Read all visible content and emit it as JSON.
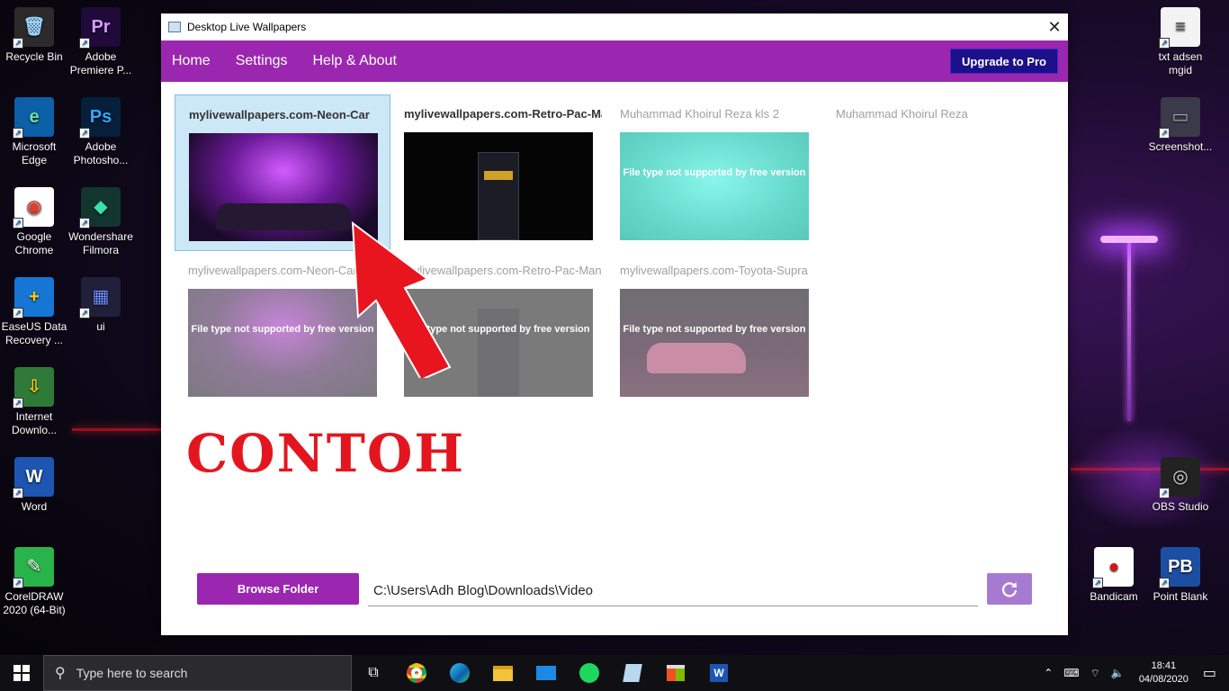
{
  "desktop": {
    "left_icons": [
      {
        "label": "Recycle Bin",
        "icon": "recycle-bin-icon",
        "glyph": "🗑",
        "bg": "#2b2b2b",
        "fg": "#9fd3ff"
      },
      {
        "label": "Adobe Premiere P...",
        "icon": "premiere-icon",
        "glyph": "Pr",
        "bg": "#1f0a3a",
        "fg": "#d79aff"
      },
      {
        "label": "Microsoft Edge",
        "icon": "edge-icon",
        "glyph": "e",
        "bg": "#0d5fa8",
        "fg": "#6ee0a5"
      },
      {
        "label": "Adobe Photosho...",
        "icon": "photoshop-icon",
        "glyph": "Ps",
        "bg": "#061f3a",
        "fg": "#2fa7ff"
      },
      {
        "label": "Google Chrome",
        "icon": "chrome-icon",
        "glyph": "◉",
        "bg": "#fff",
        "fg": "#e33b2e"
      },
      {
        "label": "Wondershare Filmora",
        "icon": "filmora-icon",
        "glyph": "◆",
        "bg": "#12362f",
        "fg": "#3de0a8"
      },
      {
        "label": "EaseUS Data Recovery ...",
        "icon": "easeus-icon",
        "glyph": "+",
        "bg": "#1576d4",
        "fg": "#ffcc00"
      },
      {
        "label": "ui",
        "icon": "folder-ui-icon",
        "glyph": "▦",
        "bg": "#20203a",
        "fg": "#6c8cff"
      },
      {
        "label": "Internet Downlo...",
        "icon": "idm-icon",
        "glyph": "⇩",
        "bg": "#2f7a38",
        "fg": "#ffd200"
      },
      {
        "label": "Word",
        "icon": "word-icon",
        "glyph": "W",
        "bg": "#1d55b2",
        "fg": "#fff"
      },
      {
        "label": "CorelDRAW 2020 (64-Bit)",
        "icon": "coreldraw-icon",
        "glyph": "✎",
        "bg": "#29b34b",
        "fg": "#fff"
      }
    ],
    "right_icons": [
      {
        "label": "txt adsen mgid",
        "icon": "text-file-icon",
        "glyph": "≡",
        "bg": "#f3f3f3",
        "fg": "#555"
      },
      {
        "label": "Screenshot...",
        "icon": "screenshot-icon",
        "glyph": "▭",
        "bg": "#3a3a4a",
        "fg": "#aaa"
      },
      {
        "label": "OBS Studio",
        "icon": "obs-icon",
        "glyph": "◎",
        "bg": "#222",
        "fg": "#ddd"
      },
      {
        "label": "Bandicam",
        "icon": "bandicam-icon",
        "glyph": "●",
        "bg": "#fff",
        "fg": "#d01818"
      },
      {
        "label": "Point Blank",
        "icon": "point-blank-icon",
        "glyph": "PB",
        "bg": "#1c4fa3",
        "fg": "#fff"
      }
    ]
  },
  "window": {
    "title": "Desktop Live Wallpapers",
    "menu": [
      "Home",
      "Settings",
      "Help & About"
    ],
    "upgrade_label": "Upgrade to Pro",
    "tiles": [
      {
        "title": "mylivewallpapers.com-Neon-Car",
        "unsupported": false
      },
      {
        "title": "mylivewallpapers.com-Retro-Pac-Man",
        "unsupported": false
      },
      {
        "title": "Muhammad Khoirul Reza kls 2",
        "unsupported": true
      },
      {
        "title": "Muhammad Khoirul Reza",
        "unsupported": true
      },
      {
        "title": "mylivewallpapers.com-Neon-Car",
        "unsupported": true
      },
      {
        "title": "mylivewallpapers.com-Retro-Pac-Man",
        "unsupported": true
      },
      {
        "title": "mylivewallpapers.com-Toyota-Supra",
        "unsupported": true
      }
    ],
    "unsupported_message": "File type not supported by free version",
    "browse_label": "Browse Folder",
    "folder_path": "C:\\Users\\Adh Blog\\Downloads\\Video"
  },
  "annotation": {
    "text": "CONTOH",
    "color": "#e3161f"
  },
  "taskbar": {
    "search_placeholder": "Type here to search",
    "time": "18:41",
    "date": "04/08/2020"
  }
}
